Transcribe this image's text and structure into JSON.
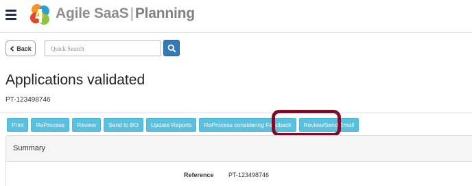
{
  "brand": {
    "name": "Agile SaaS",
    "separator": "|",
    "product": "Planning",
    "colors": {
      "text": "#8a8d91",
      "navy": "#1f2a44"
    }
  },
  "nav": {
    "back_label": "Back",
    "search": {
      "placeholder": "Quick Search",
      "value": ""
    }
  },
  "page": {
    "title": "Applications validated",
    "subtitle": "PT-123498746"
  },
  "actions": [
    {
      "label": "Print"
    },
    {
      "label": "ReProcess"
    },
    {
      "label": "Review"
    },
    {
      "label": "Send to BO"
    },
    {
      "label": "Update Reports"
    },
    {
      "label": "ReProcess considering Feedback"
    },
    {
      "label": "Review/Send Email",
      "highlighted": true
    }
  ],
  "summary": {
    "title": "Summary",
    "reference_label": "Reference",
    "reference_value": "PT-123498746"
  },
  "colors": {
    "action_button": "#5bc0de",
    "search_button": "#337ab7",
    "highlight_ring": "#7a0f2a"
  },
  "icons": {
    "menu": "hamburger-menu-icon",
    "back": "chevron-left-icon",
    "search": "magnifier-icon",
    "logo": "agile-saas-logo"
  }
}
